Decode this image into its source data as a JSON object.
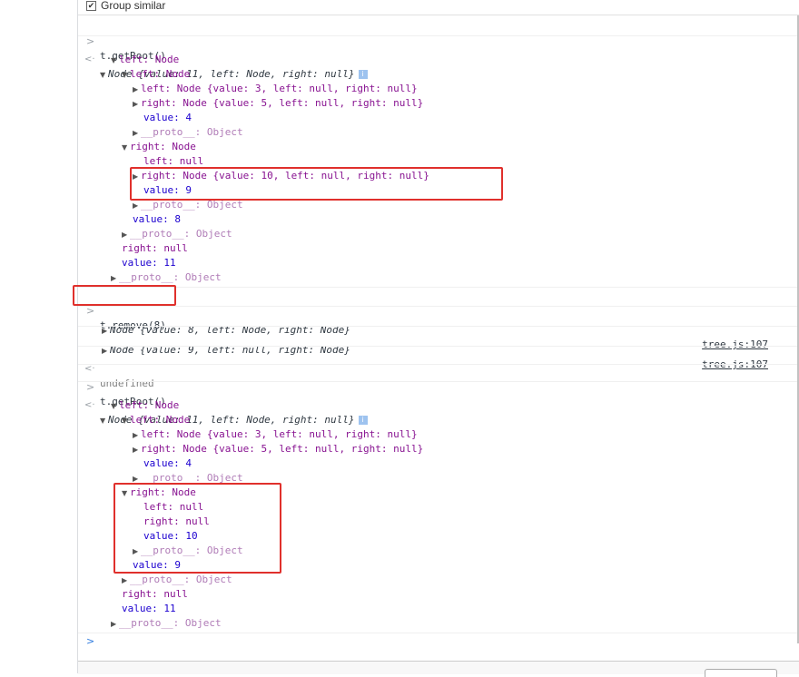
{
  "settings": {
    "group_similar_label": "Group similar",
    "checkbox_mark": "✔"
  },
  "glyphs": {
    "prompt": ">",
    "return": "<·",
    "expanded": "▼",
    "collapsed": "▶",
    "info": "i",
    "caret": ">"
  },
  "block1": {
    "command": "t.getRoot()",
    "summary": "Node {value: 11, left: Node, right: null}",
    "left_header": "left: Node",
    "left_left_header": "left: Node",
    "ll_left": "left: Node {value: 3, left: null, right: null}",
    "ll_right": "right: Node {value: 5, left: null, right: null}",
    "ll_value": "value: 4",
    "ll_proto": "__proto__: Object",
    "lr_header": "right: Node",
    "lr_left": "left: null",
    "lr_right": "right: Node {value: 10, left: null, right: null}",
    "lr_value": "value: 9",
    "lr_proto": "__proto__: Object",
    "l_value": "value: 8",
    "l_proto": "__proto__: Object",
    "root_right": "right: null",
    "root_value": "value: 11",
    "root_proto": "__proto__: Object"
  },
  "block2": {
    "command": "t.remove(8)",
    "log1": "Node {value: 8, left: Node, right: Node}",
    "log1_source": "tree.js:107",
    "log2": "Node {value: 9, left: null, right: Node}",
    "log2_source": "tree.js:107",
    "result": "undefined"
  },
  "block3": {
    "command": "t.getRoot()",
    "summary": "Node {value: 11, left: Node, right: null}",
    "left_header": "left: Node",
    "left_left_header": "left: Node",
    "ll_left": "left: Node {value: 3, left: null, right: null}",
    "ll_right": "right: Node {value: 5, left: null, right: null}",
    "ll_value": "value: 4",
    "ll_proto": "__proto__: Object",
    "lr_header": "right: Node",
    "lr_left": "left: null",
    "lr_right": "right: null",
    "lr_value": "value: 10",
    "lr_proto": "__proto__: Object",
    "l_value": "value: 9",
    "l_proto": "__proto__: Object",
    "root_right": "right: null",
    "root_value": "value: 11",
    "root_proto": "__proto__: Object"
  },
  "colors": {
    "highlight": "#e0302c",
    "key": "#881391",
    "number": "#1c00cf",
    "null": "#808080"
  }
}
